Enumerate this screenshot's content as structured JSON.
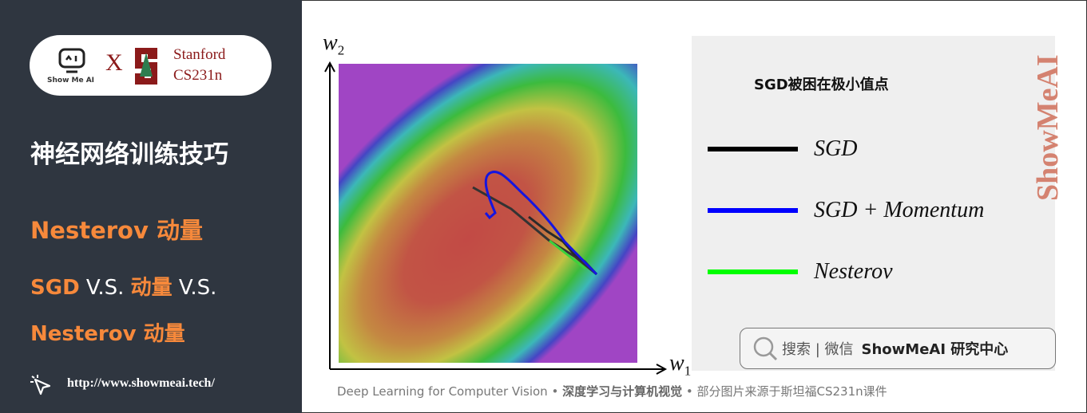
{
  "sidebar": {
    "logo": {
      "showmeai": "Show Me AI",
      "times": "X",
      "stanford": "Stanford",
      "course": "CS231n"
    },
    "course_title": "神经网络训练技巧",
    "section_title": {
      "highlight": "Nesterov 动量"
    },
    "subtitle": {
      "line1_a": "SGD",
      "line1_b": " V.S. ",
      "line1_c": "动量",
      "line1_d": " V.S.",
      "line2": "Nesterov 动量"
    },
    "url": "http://www.showmeai.tech/"
  },
  "figure": {
    "y_axis": "w",
    "y_sub": "2",
    "x_axis": "w",
    "x_sub": "1",
    "colors": {
      "sgd": "#000000",
      "momentum": "#0000ff",
      "nesterov": "#00ff00"
    }
  },
  "legend": {
    "title": "SGD被困在极小值点",
    "items": [
      {
        "label": "SGD",
        "color": "#000000"
      },
      {
        "label": "SGD + Momentum",
        "color": "#0000ff"
      },
      {
        "label": "Nesterov",
        "color": "#00ff00"
      }
    ]
  },
  "search": {
    "text": "搜索 | 微信",
    "brand": "ShowMeAI 研究中心"
  },
  "watermark": "ShowMeAI",
  "footer": {
    "en": "Deep Learning for Computer Vision",
    "dot": " • ",
    "cn": "深度学习与计算机视觉",
    "note": "部分图片来源于斯坦福CS231n课件"
  }
}
